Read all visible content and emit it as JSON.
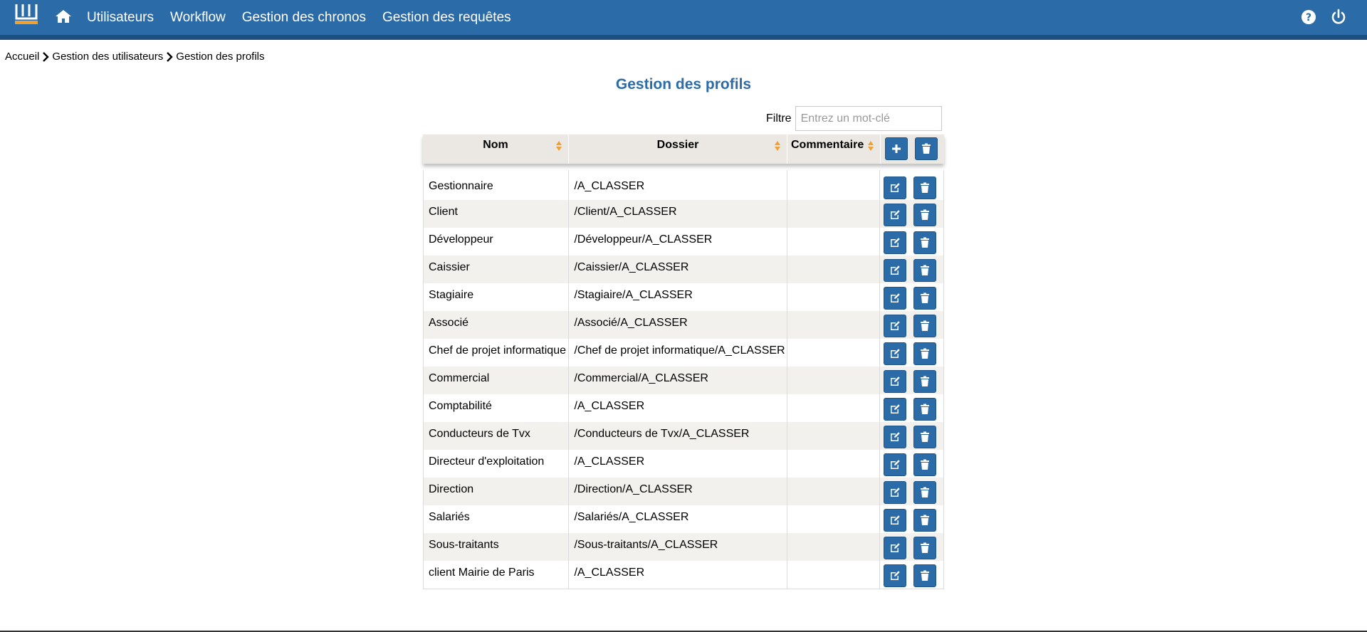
{
  "navbar": {
    "logo_letter": "W",
    "links": [
      "Utilisateurs",
      "Workflow",
      "Gestion des chronos",
      "Gestion des requêtes"
    ]
  },
  "breadcrumb": [
    "Accueil",
    "Gestion des utilisateurs",
    "Gestion des profils"
  ],
  "page_title": "Gestion des profils",
  "filter": {
    "label": "Filtre",
    "placeholder": "Entrez un mot-clé",
    "value": ""
  },
  "table": {
    "columns": [
      "Nom",
      "Dossier",
      "Commentaire"
    ],
    "rows": [
      {
        "nom": "Gestionnaire",
        "dossier": "/A_CLASSER",
        "commentaire": ""
      },
      {
        "nom": "Client",
        "dossier": "/Client/A_CLASSER",
        "commentaire": ""
      },
      {
        "nom": "Développeur",
        "dossier": "/Développeur/A_CLASSER",
        "commentaire": ""
      },
      {
        "nom": "Caissier",
        "dossier": "/Caissier/A_CLASSER",
        "commentaire": ""
      },
      {
        "nom": "Stagiaire",
        "dossier": "/Stagiaire/A_CLASSER",
        "commentaire": ""
      },
      {
        "nom": "Associé",
        "dossier": "/Associé/A_CLASSER",
        "commentaire": ""
      },
      {
        "nom": "Chef de projet informatique",
        "dossier": "/Chef de projet informatique/A_CLASSER",
        "commentaire": ""
      },
      {
        "nom": "Commercial",
        "dossier": "/Commercial/A_CLASSER",
        "commentaire": ""
      },
      {
        "nom": "Comptabilité",
        "dossier": "/A_CLASSER",
        "commentaire": ""
      },
      {
        "nom": "Conducteurs de Tvx",
        "dossier": "/Conducteurs de Tvx/A_CLASSER",
        "commentaire": ""
      },
      {
        "nom": "Directeur d'exploitation",
        "dossier": "/A_CLASSER",
        "commentaire": ""
      },
      {
        "nom": "Direction",
        "dossier": "/Direction/A_CLASSER",
        "commentaire": ""
      },
      {
        "nom": "Salariés",
        "dossier": "/Salariés/A_CLASSER",
        "commentaire": ""
      },
      {
        "nom": "Sous-traitants",
        "dossier": "/Sous-traitants/A_CLASSER",
        "commentaire": ""
      },
      {
        "nom": "client Mairie de Paris",
        "dossier": "/A_CLASSER",
        "commentaire": ""
      }
    ]
  },
  "icons": {
    "home": "home-icon",
    "help": "help-icon",
    "power": "power-icon",
    "add": "plus-icon",
    "delete": "trash-icon",
    "edit": "edit-icon",
    "sort": "sort-icon"
  },
  "colors": {
    "brand": "#2b6ca8",
    "brand_dark": "#1e4f80",
    "sort_accent": "#f0a030",
    "title": "#2b6ca8"
  }
}
